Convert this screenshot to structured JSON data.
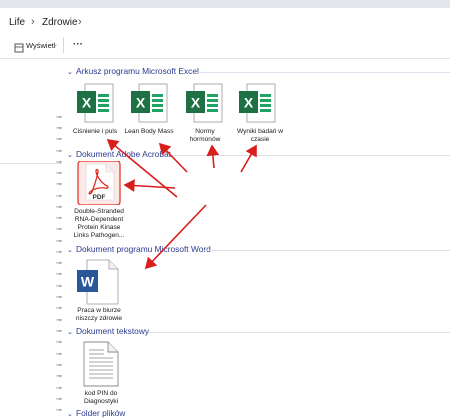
{
  "breadcrumb": {
    "items": [
      "Life",
      "Zdrowie"
    ]
  },
  "toolbar": {
    "view_label": "Wyświetl",
    "more_label": "···"
  },
  "groups": [
    {
      "title": "Arkusz programu Microsoft Excel",
      "files": [
        "Ciśnienie i puls",
        "Lean Body Mass",
        "Normy hormonów",
        "Wyniki badań w czasie"
      ],
      "icon": "excel-file-icon"
    },
    {
      "title": "Dokument Adobe Acrobat",
      "files": [
        "Double-Stranded RNA-Dependent Protein Kinase Links Pathogen..."
      ],
      "icon": "pdf-file-icon"
    },
    {
      "title": "Dokument programu Microsoft Word",
      "files": [
        "Praca w biurze niszczy zdrowie"
      ],
      "icon": "word-file-icon"
    },
    {
      "title": "Dokument tekstowy",
      "files": [
        "kod PIN do Diagnostyki"
      ],
      "icon": "text-file-icon"
    },
    {
      "title": "Folder plików",
      "files": [],
      "icon": "folder-icon"
    }
  ],
  "colors": {
    "group_header": "#2a3b8f",
    "excel_green": "#1e7145",
    "pdf_red": "#e02b20",
    "word_blue": "#2b579a",
    "annotation_arrow": "#d91e1e"
  }
}
